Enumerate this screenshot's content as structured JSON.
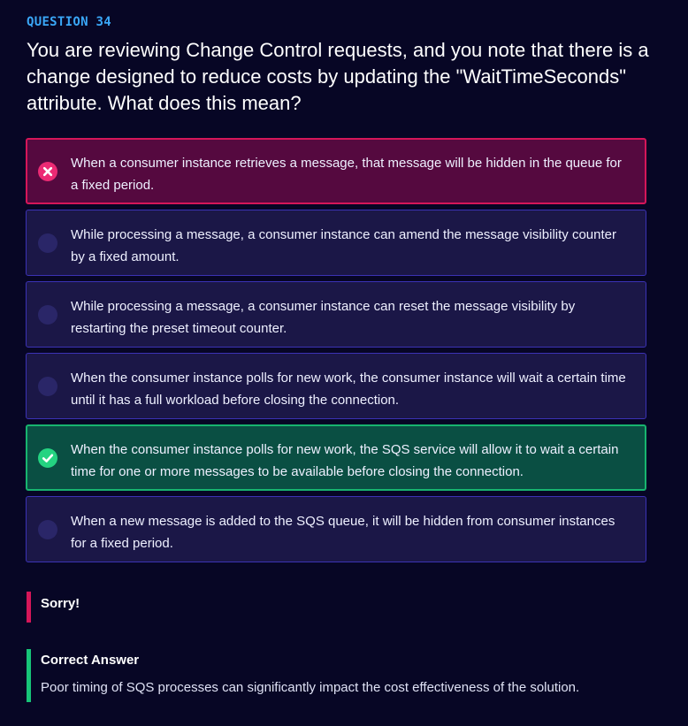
{
  "question": {
    "number_label": "QUESTION 34",
    "text": "You are reviewing Change Control requests, and you note that there is a change designed to reduce costs by updating the \"WaitTimeSeconds\" attribute. What does this mean?"
  },
  "options": [
    {
      "text": "When a consumer instance retrieves a message, that message will be hidden in the queue for a fixed period.",
      "state": "wrong",
      "icon": "x-circle-icon"
    },
    {
      "text": "While processing a message, a consumer instance can amend the message visibility counter by a fixed amount.",
      "state": "neutral",
      "icon": "radio-icon"
    },
    {
      "text": "While processing a message, a consumer instance can reset the message visibility by restarting the preset timeout counter.",
      "state": "neutral",
      "icon": "radio-icon"
    },
    {
      "text": "When the consumer instance polls for new work, the consumer instance will wait a certain time until it has a full workload before closing the connection.",
      "state": "neutral",
      "icon": "radio-icon"
    },
    {
      "text": "When the consumer instance polls for new work, the SQS service will allow it to wait a certain time for one or more messages to be available before closing the connection.",
      "state": "correct",
      "icon": "check-circle-icon"
    },
    {
      "text": "When a new message is added to the SQS queue, it will be hidden from consumer instances for a fixed period.",
      "state": "neutral",
      "icon": "radio-icon"
    }
  ],
  "feedback": {
    "result_label": "Sorry!",
    "correct_answer_title": "Correct Answer",
    "explanation": "Poor timing of SQS processes can significantly impact the cost effectiveness of the solution."
  },
  "colors": {
    "background": "#070625",
    "accent_blue": "#3aa7f7",
    "wrong": "#d51659",
    "correct": "#17b46f",
    "option_bg": "#1b1747",
    "option_border": "#3b32b5"
  }
}
